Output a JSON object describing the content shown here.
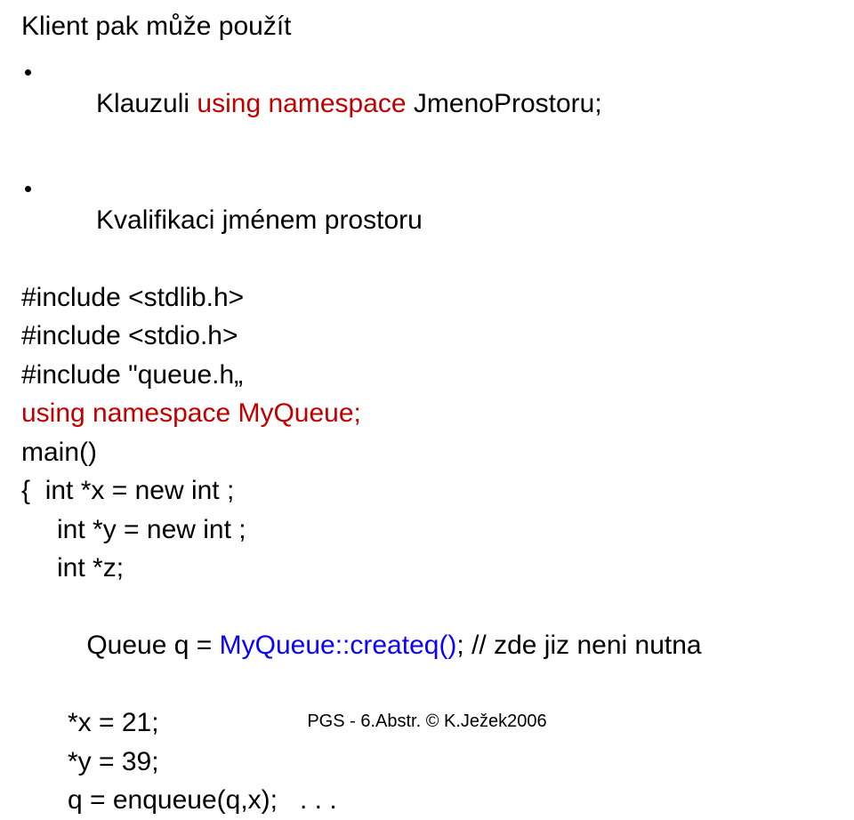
{
  "title": "Klient pak může použít",
  "bullets": [
    {
      "pre": "Klauzuli ",
      "kw": "using namespace",
      "post": " JmenoProstoru;"
    },
    {
      "pre": "Kvalifikaci jménem prostoru",
      "kw": "",
      "post": ""
    }
  ],
  "code": {
    "inc1": "#include <stdlib.h>",
    "inc2": "#include <stdio.h>",
    "inc3": "#include \"queue.h„",
    "usens": "using namespace MyQueue;",
    "mainline": "main()",
    "brace_intx": "{  int *x = new int ;",
    "inty": "int *y = new int ;",
    "intz": "int *z;",
    "queue_pre": "Queue q = ",
    "queue_call": "MyQueue::createq()",
    "queue_post": "; // zde jiz neni nutna",
    "x21": "*x = 21;",
    "y39": "*y = 39;",
    "enq": "q = enqueue(q,x);   . . ."
  },
  "footer": "PGS - 6.Abstr.  © K.Ježek2006"
}
